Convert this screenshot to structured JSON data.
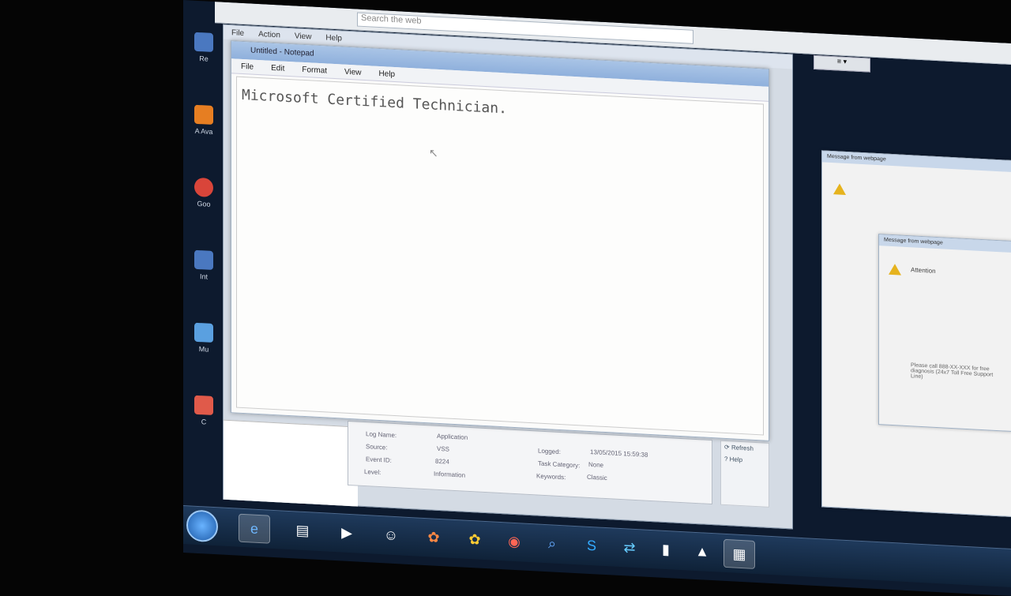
{
  "browser": {
    "search_placeholder": "Search the web",
    "ctrl_label": "≡ ▾"
  },
  "desktop": {
    "icons": [
      {
        "label": "Re"
      },
      {
        "label": "A Ava"
      },
      {
        "label": "Goo"
      },
      {
        "label": "Int"
      },
      {
        "label": "Mu"
      },
      {
        "label": "C"
      }
    ]
  },
  "back_window": {
    "menu": [
      "File",
      "Action",
      "View",
      "Help"
    ]
  },
  "notepad": {
    "title": "Untitled - Notepad",
    "menu": [
      "File",
      "Edit",
      "Format",
      "View",
      "Help"
    ],
    "content": "Microsoft Certified Technician."
  },
  "event_details": {
    "log_name_label": "Log Name:",
    "log_name": "Application",
    "source_label": "Source:",
    "source": "VSS",
    "event_id_label": "Event ID:",
    "event_id": "8224",
    "level_label": "Level:",
    "level": "Information",
    "logged_label": "Logged:",
    "logged": "13/05/2015 15:59:38",
    "task_category_label": "Task Category:",
    "task_category": "None",
    "keywords_label": "Keywords:",
    "keywords": "Classic"
  },
  "actions": {
    "refresh": "Refresh",
    "help": "Help"
  },
  "dialogs": {
    "message_title": "Message from webpage",
    "attention": "Attention",
    "support_line": "Please call 888-XX-XXX for free diagnosis (24x7 Toll Free Support Line)"
  },
  "taskbar": {
    "apps": [
      "internet-explorer",
      "file-explorer",
      "media-player",
      "messenger",
      "pinwheel-app",
      "pinwheel-app-2",
      "chrome",
      "search-app",
      "skype",
      "teamviewer",
      "command-prompt",
      "event-viewer",
      "notepad"
    ]
  },
  "colors": {
    "warning": "#e6b31e",
    "taskbar": "#1f3a5c",
    "title_bar": "#a9c4e6"
  }
}
